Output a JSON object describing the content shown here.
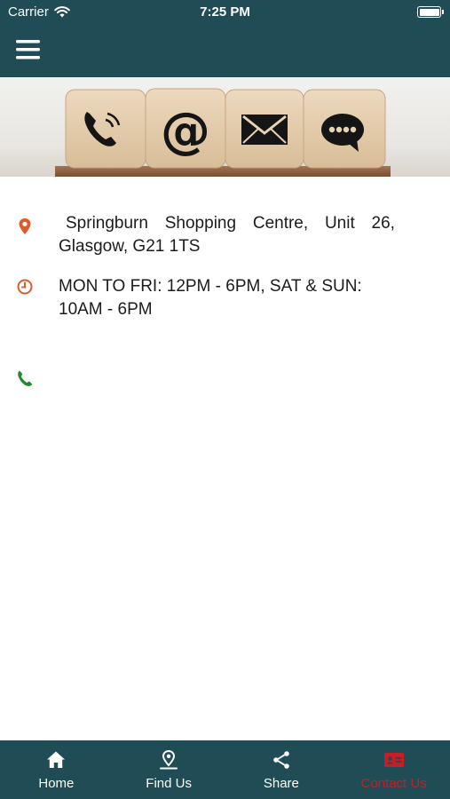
{
  "status_bar": {
    "carrier": "Carrier",
    "time": "7:25 PM"
  },
  "header": {
    "menu_icon": "hamburger-icon"
  },
  "hero": {
    "dice": [
      "phone-icon",
      "at-icon",
      "envelope-icon",
      "chat-icon"
    ]
  },
  "contact": {
    "address_line1_words": [
      "Springburn",
      "Shopping",
      "Centre,",
      "Unit",
      "26,"
    ],
    "address_line2": "Glasgow, G21 1TS",
    "hours_line1": "MON TO FRI: 12PM - 6PM, SAT & SUN:",
    "hours_line2": "10AM - 6PM",
    "phone": "",
    "icons": {
      "address": "location-pin-icon",
      "hours": "clock-icon",
      "phone": "phone-icon"
    },
    "colors": {
      "pin": "#e05a2a",
      "clock": "#e05a2a",
      "phone": "#1f8a2e"
    }
  },
  "tabbar": {
    "tabs": [
      {
        "label": "Home",
        "icon": "home-icon"
      },
      {
        "label": "Find Us",
        "icon": "map-pin-icon"
      },
      {
        "label": "Share",
        "icon": "share-icon"
      },
      {
        "label": "Contact Us",
        "icon": "contact-card-icon",
        "active": true
      }
    ]
  },
  "colors": {
    "bar": "#1f4c55",
    "active_tab": "#c81d25",
    "text": "#1b1b1b"
  }
}
